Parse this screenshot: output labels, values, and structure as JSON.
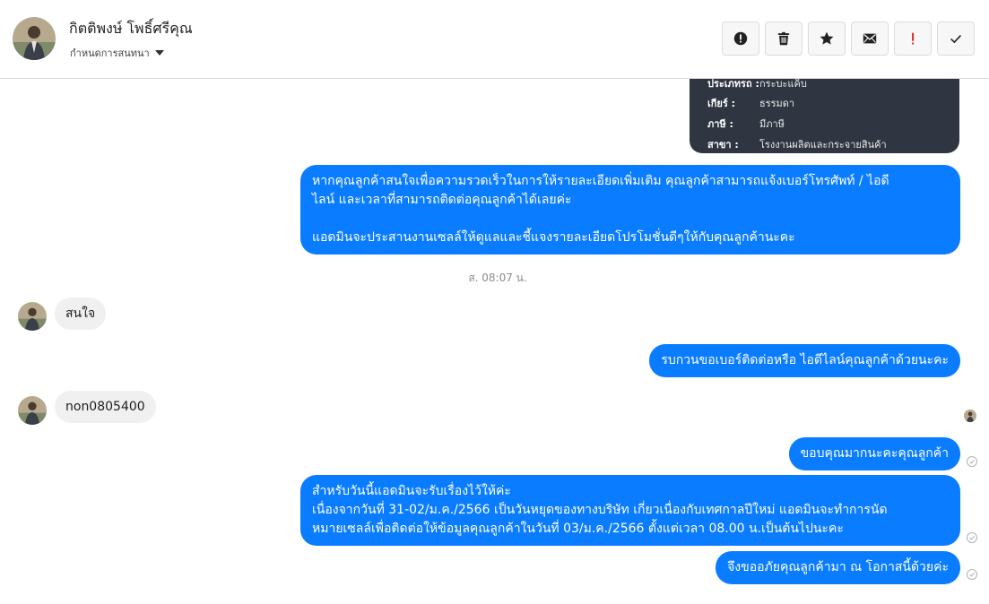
{
  "header": {
    "contact_name": "กิตติพงษ์ โพธิ์ศรีคุณ",
    "subtitle": "กำหนดการสนทนา",
    "actions": [
      {
        "name": "alert-icon",
        "label": "spam"
      },
      {
        "name": "trash-icon",
        "label": "delete"
      },
      {
        "name": "star-icon",
        "label": "star"
      },
      {
        "name": "mail-icon",
        "label": "unread"
      },
      {
        "name": "exclamation-icon",
        "label": "important"
      },
      {
        "name": "check-icon",
        "label": "done"
      }
    ]
  },
  "product_card": {
    "rows": [
      {
        "key": "ประเภทรถ :",
        "value": "กระบะแค็บ"
      },
      {
        "key": "เกียร์ :",
        "value": "ธรรมดา"
      },
      {
        "key": "ภาษี :",
        "value": "มีภาษี"
      },
      {
        "key": "สาขา :",
        "value": "โรงงานผลิตและกระจายสินค้า"
      }
    ]
  },
  "messages": {
    "m1": {
      "lines": [
        "หากคุณลูกค้าสนใจเพื่อความรวดเร็วในการให้รายละเอียดเพิ่มเติม คุณลูกค้าสามารถแจ้งเบอร์โทรศัพท์ / ไอดี",
        "ไลน์ และเวลาที่สามารถติดต่อคุณลูกค้าได้เลยค่ะ",
        "แอดมินจะประสานงานเซลล์ให้ดูแลและชี้แจงรายละเอียดโปรโมชั่นดีๆให้กับคุณลูกค้านะคะ"
      ]
    },
    "timestamp": "ส. 08:07 น.",
    "m2": "สนใจ",
    "m3": "รบกวนขอเบอร์ติดต่อหรือ ไอดีไลน์คุณลูกค้าด้วยนะคะ",
    "m4": "non0805400",
    "m5": "ขอบคุณมากนะคะคุณลูกค้า",
    "m6": {
      "lines": [
        "สำหรับวันนี้แอดมินจะรับเรื่องไว้ให้ค่ะ",
        "เนื่องจากวันที่ 31-02/ม.ค./2566 เป็นวันหยุดของทางบริษัท เกี่ยวเนื่องกับเทศกาลปีใหม่ แอดมินจะทำการนัด",
        "หมายเซลล์เพื่อติดต่อให้ข้อมูลคุณลูกค้าในวันที่ 03/ม.ค./2566 ตั้งแต่เวลา 08.00 น.เป็นต้นไปนะคะ"
      ]
    },
    "m7": "จึงขออภัยคุณลูกค้ามา ณ โอกาสนี้ด้วยค่ะ"
  },
  "colors": {
    "outgoing_bubble": "#0a7cff",
    "incoming_bubble": "#f0f0f0",
    "card_bg": "#2f3642"
  }
}
